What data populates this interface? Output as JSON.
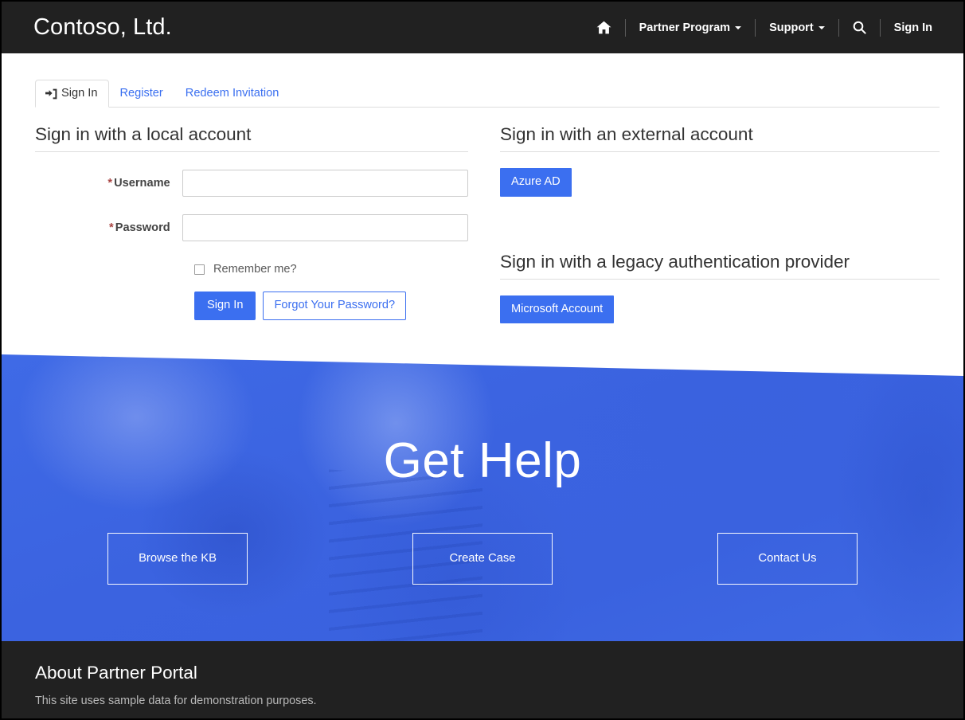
{
  "navbar": {
    "brand": "Contoso, Ltd.",
    "home_icon": "home-icon",
    "items": [
      {
        "label": "Partner Program",
        "has_caret": true
      },
      {
        "label": "Support",
        "has_caret": true
      }
    ],
    "search_icon": "search-icon",
    "signin_label": "Sign In"
  },
  "tabs": [
    {
      "label": "Sign In",
      "icon": "sign-in-icon",
      "active": true
    },
    {
      "label": "Register",
      "active": false
    },
    {
      "label": "Redeem Invitation",
      "active": false
    }
  ],
  "local_account": {
    "heading": "Sign in with a local account",
    "username": {
      "label": "Username",
      "required_marker": "*",
      "value": "",
      "placeholder": ""
    },
    "password": {
      "label": "Password",
      "required_marker": "*",
      "value": "",
      "placeholder": ""
    },
    "remember_me": {
      "label": "Remember me?",
      "checked": false
    },
    "signin_button": "Sign In",
    "forgot_button": "Forgot Your Password?"
  },
  "external_account": {
    "heading": "Sign in with an external account",
    "providers": [
      {
        "label": "Azure AD"
      }
    ]
  },
  "legacy_account": {
    "heading": "Sign in with a legacy authentication provider",
    "providers": [
      {
        "label": "Microsoft Account"
      }
    ]
  },
  "hero": {
    "title": "Get Help",
    "buttons": [
      {
        "label": "Browse the KB"
      },
      {
        "label": "Create Case"
      },
      {
        "label": "Contact Us"
      }
    ]
  },
  "footer": {
    "title": "About Partner Portal",
    "subtitle": "This site uses sample data for demonstration purposes."
  },
  "colors": {
    "nav_background": "#212121",
    "accent_blue": "#3b6ff0",
    "hero_blue": "#3c63e0",
    "link_blue": "#3a6ff0",
    "required_red": "#a94442",
    "border_gray": "#dddddd"
  }
}
